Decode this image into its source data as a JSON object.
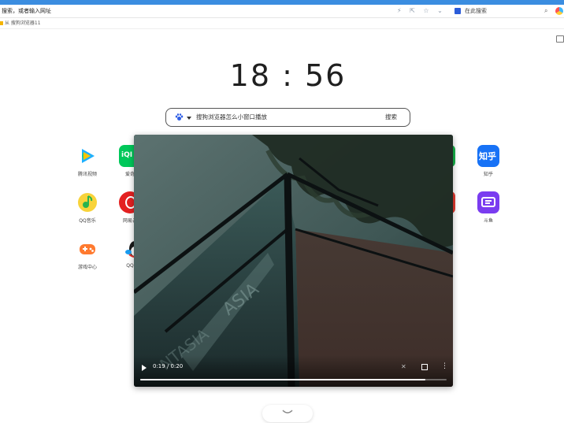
{
  "address_bar": {
    "text": "搜索，或者输入网址",
    "search_engine_label": "在此搜索"
  },
  "bookmarks": {
    "item": "从 搜狗浏览器11"
  },
  "clock": {
    "time": "18 : 56"
  },
  "search": {
    "query": "搜狗浏览器怎么小窗口播放",
    "button": "搜索"
  },
  "apps": [
    {
      "label": "腾讯视频",
      "color": "#1db0ff"
    },
    {
      "label": "爱奇",
      "color": "#00c85a"
    },
    {
      "label": "QQ音乐",
      "color": "#f8d33a"
    },
    {
      "label": "网易云",
      "color": "#e42121"
    },
    {
      "label": "游戏中心",
      "color": "#ff7a2f"
    },
    {
      "label": "QQ",
      "color": "#1a9cf0"
    },
    {
      "label": "知乎",
      "color": "#1772f6",
      "tile_text": "知乎"
    },
    {
      "label": "斗鱼",
      "color": "#7a3cf0"
    }
  ],
  "video": {
    "time": "0:19 / 0:20",
    "progress": 0.93
  }
}
